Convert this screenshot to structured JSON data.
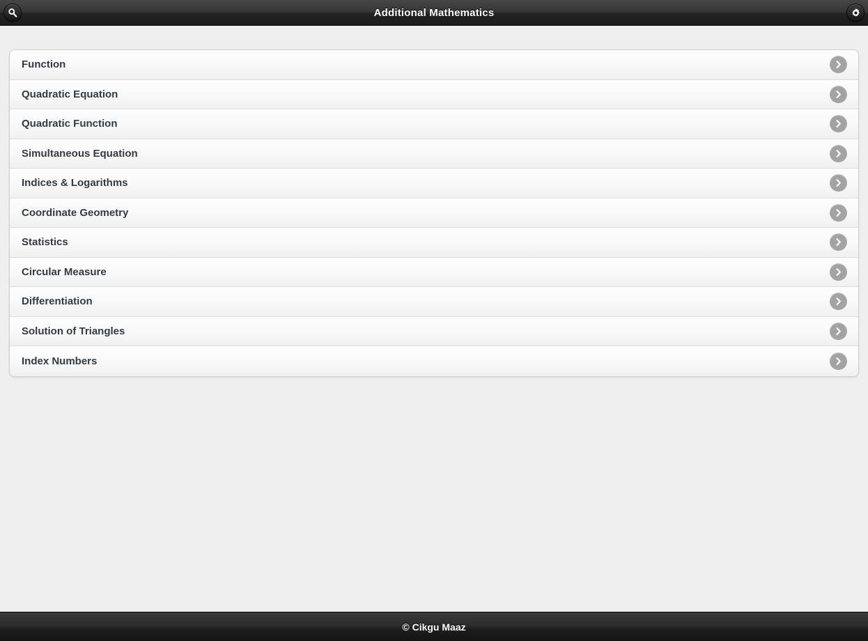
{
  "header": {
    "title": "Additional Mathematics",
    "search_icon": "search-icon",
    "settings_icon": "gear-icon"
  },
  "main": {
    "items": [
      {
        "label": "Function",
        "chevron": "chevron-right-icon"
      },
      {
        "label": "Quadratic Equation",
        "chevron": "chevron-right-icon"
      },
      {
        "label": "Quadratic Function",
        "chevron": "chevron-right-icon"
      },
      {
        "label": "Simultaneous Equation",
        "chevron": "chevron-right-icon"
      },
      {
        "label": "Indices & Logarithms",
        "chevron": "chevron-right-icon"
      },
      {
        "label": "Coordinate Geometry",
        "chevron": "chevron-right-icon"
      },
      {
        "label": "Statistics",
        "chevron": "chevron-right-icon"
      },
      {
        "label": "Circular Measure",
        "chevron": "chevron-right-icon"
      },
      {
        "label": "Differentiation",
        "chevron": "chevron-right-icon"
      },
      {
        "label": "Solution of Triangles",
        "chevron": "chevron-right-icon"
      },
      {
        "label": "Index Numbers",
        "chevron": "chevron-right-icon"
      }
    ]
  },
  "footer": {
    "copyright": "© Cikgu Maaz"
  },
  "colors": {
    "bar_dark": "#2b2b2b",
    "page_background": "#efefef",
    "row_background": "#f9f9f9",
    "label_text": "#34393d",
    "chevron_circle": "#a3a3a3"
  }
}
